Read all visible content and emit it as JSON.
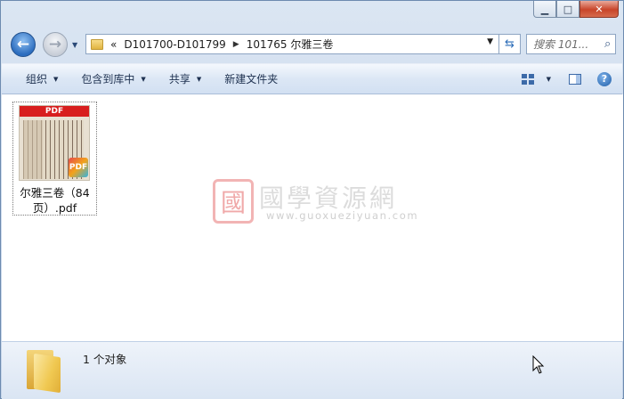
{
  "window": {
    "caption_buttons": {
      "minimize": "▭",
      "maximize": "□",
      "close": "✕"
    }
  },
  "nav": {
    "back_glyph": "←",
    "forward_glyph": "→",
    "address": {
      "overflow": "«",
      "crumbs": [
        "D101700-D101799",
        "101765 尔雅三卷"
      ]
    },
    "search_placeholder": "搜索 101..."
  },
  "toolbar": {
    "organize": "组织",
    "include_in_library": "包含到库中",
    "share": "共享",
    "new_folder": "新建文件夹"
  },
  "files": [
    {
      "name": "尔雅三卷（84页）.pdf",
      "name_line1": "尔雅三卷（84",
      "name_line2": "页）.pdf",
      "thumb_label": "PDF",
      "badge": "PDF"
    }
  ],
  "watermark": {
    "logo_char": "國",
    "title": "國學資源網",
    "url": "www.guoxueziyuan.com"
  },
  "status": {
    "count_text": "1 个对象"
  },
  "colors": {
    "accent": "#2c6dbf",
    "pdf_red": "#d81e1e"
  }
}
